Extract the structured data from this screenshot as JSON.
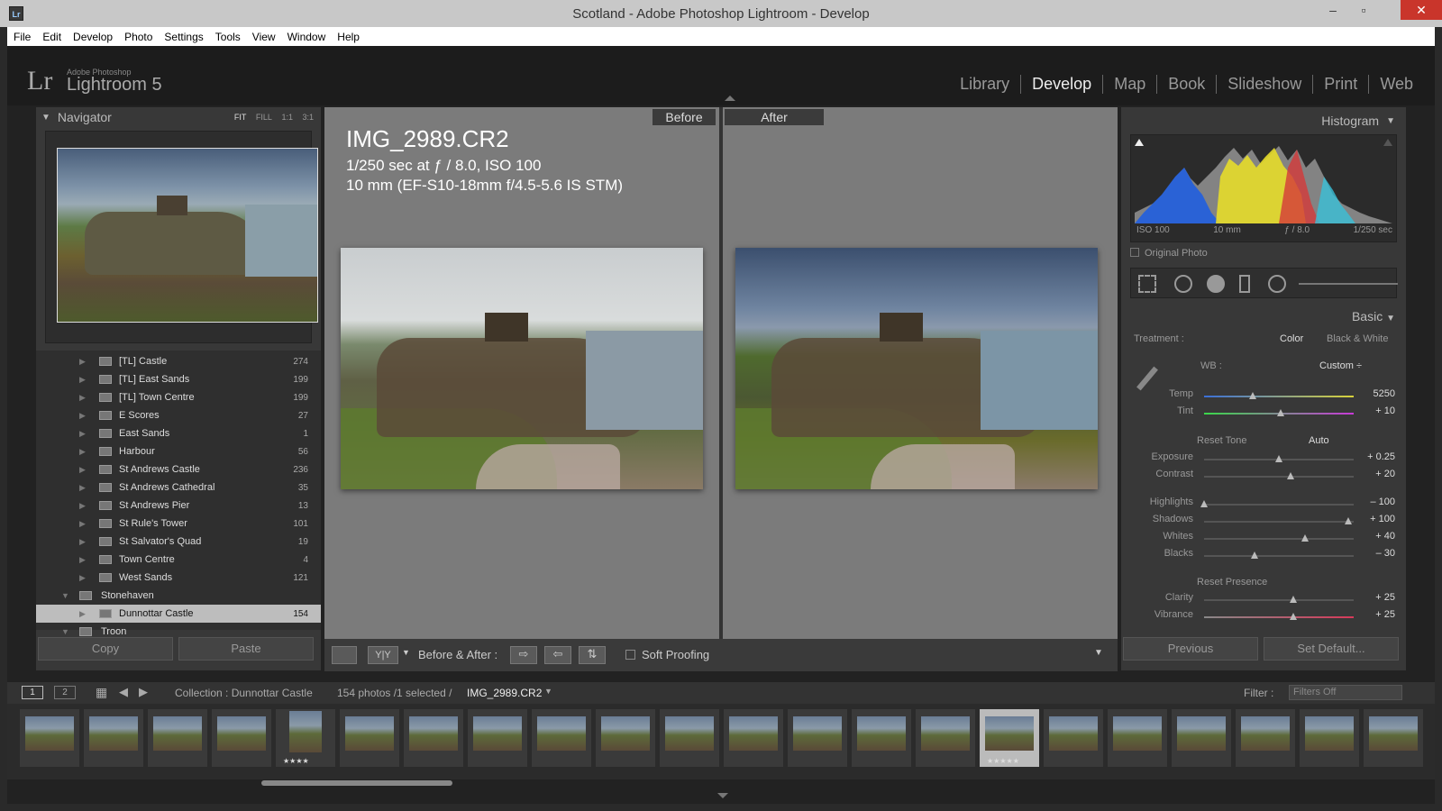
{
  "window": {
    "title": "Scotland - Adobe Photoshop Lightroom - Develop",
    "icon_text": "Lr"
  },
  "menu": [
    "File",
    "Edit",
    "Develop",
    "Photo",
    "Settings",
    "Tools",
    "View",
    "Window",
    "Help"
  ],
  "identity": {
    "mark": "Lr",
    "small": "Adobe Photoshop",
    "big": "Lightroom 5"
  },
  "modules": [
    "Library",
    "Develop",
    "Map",
    "Book",
    "Slideshow",
    "Print",
    "Web"
  ],
  "navigator": {
    "title": "Navigator",
    "zoom": [
      "FIT",
      "FILL",
      "1:1",
      "3:1"
    ]
  },
  "folders": [
    {
      "name": "[TL] Castle",
      "count": "274"
    },
    {
      "name": "[TL] East Sands",
      "count": "199"
    },
    {
      "name": "[TL] Town Centre",
      "count": "199"
    },
    {
      "name": "E Scores",
      "count": "27"
    },
    {
      "name": "East Sands",
      "count": "1"
    },
    {
      "name": "Harbour",
      "count": "56"
    },
    {
      "name": "St Andrews Castle",
      "count": "236"
    },
    {
      "name": "St Andrews Cathedral",
      "count": "35"
    },
    {
      "name": "St Andrews Pier",
      "count": "13"
    },
    {
      "name": "St Rule's Tower",
      "count": "101"
    },
    {
      "name": "St Salvator's Quad",
      "count": "19"
    },
    {
      "name": "Town Centre",
      "count": "4"
    },
    {
      "name": "West Sands",
      "count": "121"
    }
  ],
  "folder_groups": {
    "stonehaven": "Stonehaven",
    "dunnottar": "Dunnottar Castle",
    "dunnottar_count": "154",
    "troon": "Troon"
  },
  "left_buttons": {
    "copy": "Copy",
    "paste": "Paste"
  },
  "view": {
    "before": "Before",
    "after": "After",
    "filename": "IMG_2989.CR2",
    "exposure": "1/250 sec at ƒ / 8.0, ISO 100",
    "lens": "10 mm (EF-S10-18mm f/4.5-5.6 IS STM)"
  },
  "toolbar": {
    "ba_label": "Before & After :",
    "soft_proofing": "Soft Proofing",
    "yy": "Y|Y"
  },
  "histogram": {
    "title": "Histogram",
    "iso": "ISO 100",
    "focal": "10 mm",
    "aperture": "ƒ / 8.0",
    "shutter": "1/250 sec",
    "original": "Original Photo"
  },
  "basic": {
    "title": "Basic",
    "treatment_label": "Treatment :",
    "color": "Color",
    "bw": "Black & White",
    "wb_label": "WB :",
    "wb_value": "Custom ÷",
    "reset_tone": "Reset Tone",
    "auto": "Auto",
    "reset_presence": "Reset Presence",
    "sliders": [
      {
        "label": "Temp",
        "value": "5250",
        "pos": 0.34
      },
      {
        "label": "Tint",
        "value": "+ 10",
        "pos": 0.53
      },
      {
        "label": "Exposure",
        "value": "+ 0.25",
        "pos": 0.52
      },
      {
        "label": "Contrast",
        "value": "+ 20",
        "pos": 0.6
      },
      {
        "label": "Highlights",
        "value": "– 100",
        "pos": 0.0
      },
      {
        "label": "Shadows",
        "value": "+ 100",
        "pos": 1.0
      },
      {
        "label": "Whites",
        "value": "+ 40",
        "pos": 0.7
      },
      {
        "label": "Blacks",
        "value": "– 30",
        "pos": 0.35
      },
      {
        "label": "Clarity",
        "value": "+ 25",
        "pos": 0.62
      },
      {
        "label": "Vibrance",
        "value": "+ 25",
        "pos": 0.62
      }
    ]
  },
  "right_buttons": {
    "previous": "Previous",
    "set_default": "Set Default..."
  },
  "filmbar": {
    "collection": "Collection : Dunnottar Castle",
    "count": "154 photos /1 selected /",
    "file": "IMG_2989.CR2",
    "filter_label": "Filter :",
    "filter_value": "Filters Off",
    "page1": "1",
    "page2": "2"
  },
  "filmstrip_stars": {
    "a": "★★★★",
    "b": "★★★★★"
  }
}
